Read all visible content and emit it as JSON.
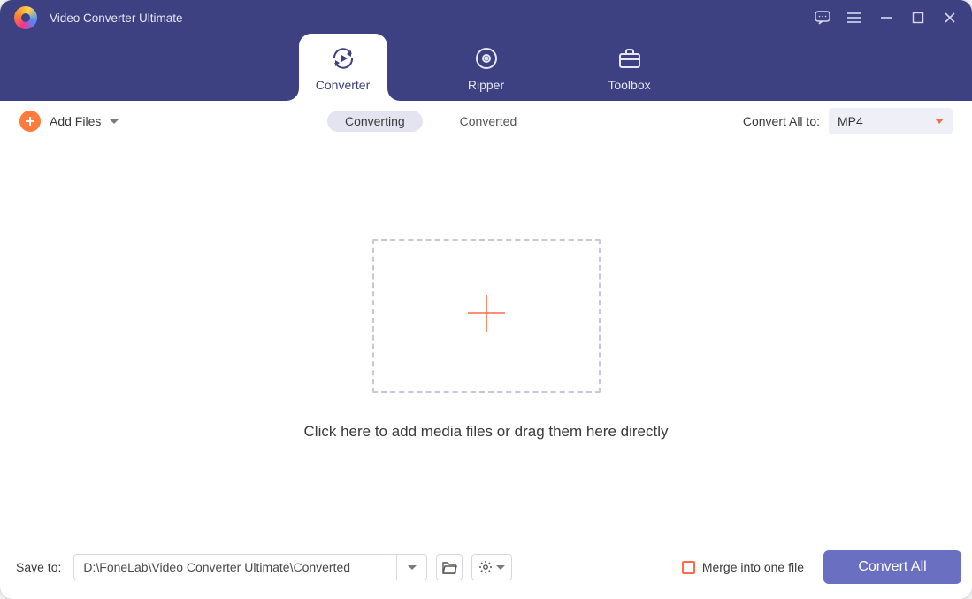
{
  "app": {
    "title": "Video Converter Ultimate"
  },
  "tabs": {
    "converter": "Converter",
    "ripper": "Ripper",
    "toolbox": "Toolbox",
    "active": "converter"
  },
  "toolbar": {
    "add_files": "Add Files",
    "status": {
      "converting": "Converting",
      "converted": "Converted",
      "active": "converting"
    },
    "convert_all_to_label": "Convert All to:",
    "format_selected": "MP4"
  },
  "drop": {
    "hint": "Click here to add media files or drag them here directly"
  },
  "bottom": {
    "save_to_label": "Save to:",
    "path": "D:\\FoneLab\\Video Converter Ultimate\\Converted",
    "merge_label": "Merge into one file",
    "convert_all": "Convert All"
  }
}
